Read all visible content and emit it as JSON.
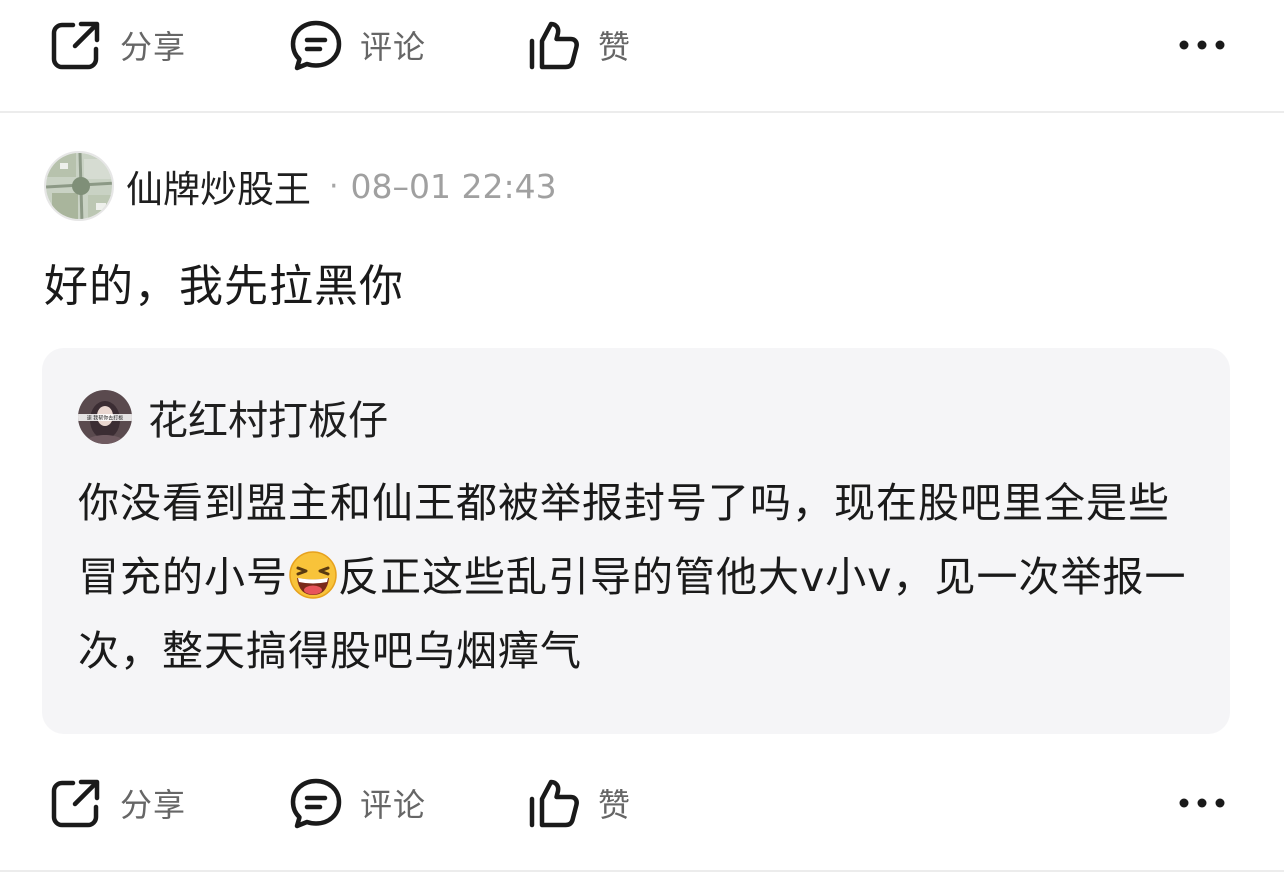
{
  "top_actions": {
    "share": "分享",
    "comment": "评论",
    "like": "赞"
  },
  "comment": {
    "username": "仙牌炒股王",
    "separator": "·",
    "timestamp": "08–01 22:43",
    "text": "好的，我先拉黑你",
    "avatar_icon": "satellite-map-avatar"
  },
  "quote": {
    "username": "花红村打板仔",
    "avatar_icon": "portrait-avatar",
    "avatar_caption": "速 我帮你去打板",
    "text_part1": "你没看到盟主和仙王都被举报封号了吗，现在股吧里全是些冒充的小号",
    "emoji": "grinning-squinting-face",
    "text_part2": "反正这些乱引导的管他大v小v，见一次举报一次，整天搞得股吧乌烟瘴气"
  },
  "bottom_actions": {
    "share": "分享",
    "comment": "评论",
    "like": "赞"
  },
  "colors": {
    "card_bg": "#f5f5f7",
    "meta_gray": "#a0a0a0",
    "action_gray": "#666666"
  }
}
